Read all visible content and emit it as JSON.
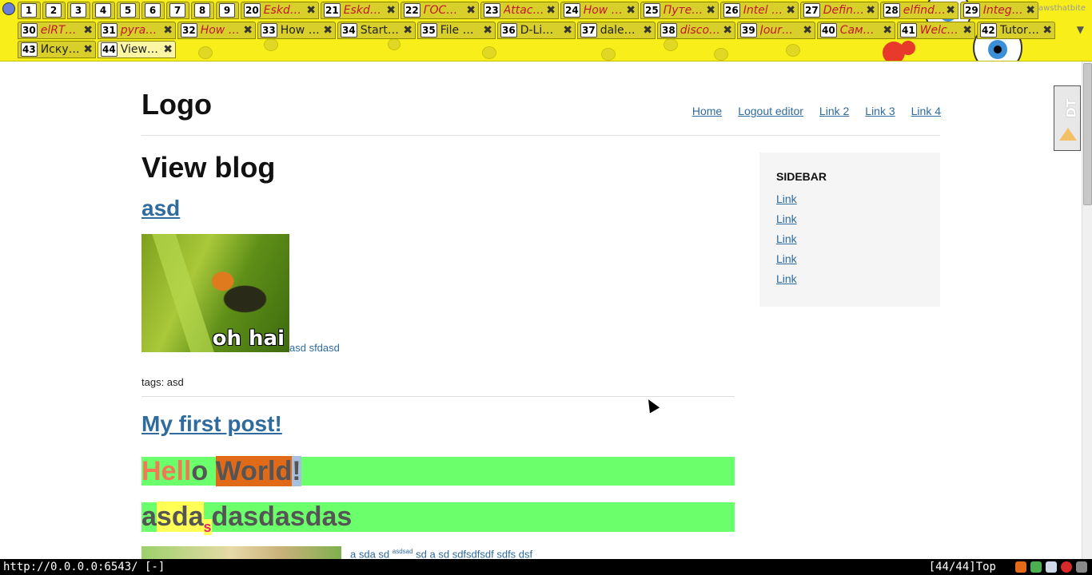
{
  "tabs": {
    "row1": [
      {
        "num": "1",
        "title": "",
        "small": true
      },
      {
        "num": "2",
        "title": "",
        "small": true
      },
      {
        "num": "3",
        "title": "",
        "small": true
      },
      {
        "num": "4",
        "title": "",
        "small": true
      },
      {
        "num": "5",
        "title": "",
        "small": true
      },
      {
        "num": "6",
        "title": "",
        "small": true
      },
      {
        "num": "7",
        "title": "",
        "small": true
      },
      {
        "num": "8",
        "title": "",
        "small": true
      },
      {
        "num": "9",
        "title": "",
        "small": true
      },
      {
        "num": "20",
        "title": "Eskd…",
        "italic": true
      },
      {
        "num": "21",
        "title": "Eskd…",
        "italic": true
      },
      {
        "num": "22",
        "title": "ГОС…",
        "italic": true
      },
      {
        "num": "23",
        "title": "Attac…",
        "italic": true
      },
      {
        "num": "24",
        "title": "How …",
        "italic": true
      },
      {
        "num": "25",
        "title": "Путе…",
        "italic": true
      },
      {
        "num": "26",
        "title": "Intel …",
        "italic": true
      },
      {
        "num": "27",
        "title": "Defin…",
        "italic": true
      },
      {
        "num": "28",
        "title": "elfind…",
        "italic": true
      },
      {
        "num": "29",
        "title": "Integ…",
        "italic": true
      }
    ],
    "row2": [
      {
        "num": "30",
        "title": "elRT…",
        "italic": true
      },
      {
        "num": "31",
        "title": "pyra…",
        "italic": true
      },
      {
        "num": "32",
        "title": "How …",
        "italic": true
      },
      {
        "num": "33",
        "title": "How …",
        "italic": false
      },
      {
        "num": "34",
        "title": "Start…",
        "italic": false
      },
      {
        "num": "35",
        "title": "File …",
        "italic": false
      },
      {
        "num": "36",
        "title": "D-Li…",
        "italic": false
      },
      {
        "num": "37",
        "title": "dale…",
        "italic": false
      },
      {
        "num": "38",
        "title": "disco…",
        "italic": true
      },
      {
        "num": "39",
        "title": "Jour…",
        "italic": true
      },
      {
        "num": "40",
        "title": "Сам…",
        "italic": true
      },
      {
        "num": "41",
        "title": "Welc…",
        "italic": true
      },
      {
        "num": "42",
        "title": "Tutor…",
        "italic": false
      }
    ],
    "row3": [
      {
        "num": "43",
        "title": "Иску…",
        "italic": false
      },
      {
        "num": "44",
        "title": "View…",
        "italic": false,
        "active": true
      }
    ],
    "close_glyph": "✖",
    "hint": "jawsthatbite",
    "menu_glyph": "▼"
  },
  "site": {
    "logo": "Logo",
    "nav": [
      "Home",
      "Logout editor",
      "Link 2",
      "Link 3",
      "Link 4"
    ]
  },
  "main": {
    "heading": "View blog",
    "post1": {
      "title": "asd",
      "image_caption": "oh hai",
      "text": "asd sfdasd",
      "tags": "tags: asd"
    },
    "post2": {
      "title": "My first post!",
      "hello": {
        "p1": "Hell",
        "p2": "o ",
        "p3": "World",
        "p4": "!"
      },
      "asd": {
        "p1": "a",
        "p2": "sda",
        "p3": "s",
        "p4": "dasdasdas"
      }
    },
    "post3": {
      "text_a": "a sda sd ",
      "text_sup": "asdsad",
      "text_b": " sd a sd sdfsdfsdf sdfs dsf"
    }
  },
  "sidebar": {
    "title": "SIDEBAR",
    "links": [
      "Link",
      "Link",
      "Link",
      "Link",
      "Link"
    ]
  },
  "dt_badge": "DT",
  "status": {
    "url": "http://0.0.0.0:6543/ [-]",
    "position": "[44/44]Top"
  },
  "colors": {
    "tabbar": "#f8ef1a",
    "link": "#2f6b9c",
    "highlight_green": "#6bff6b"
  }
}
